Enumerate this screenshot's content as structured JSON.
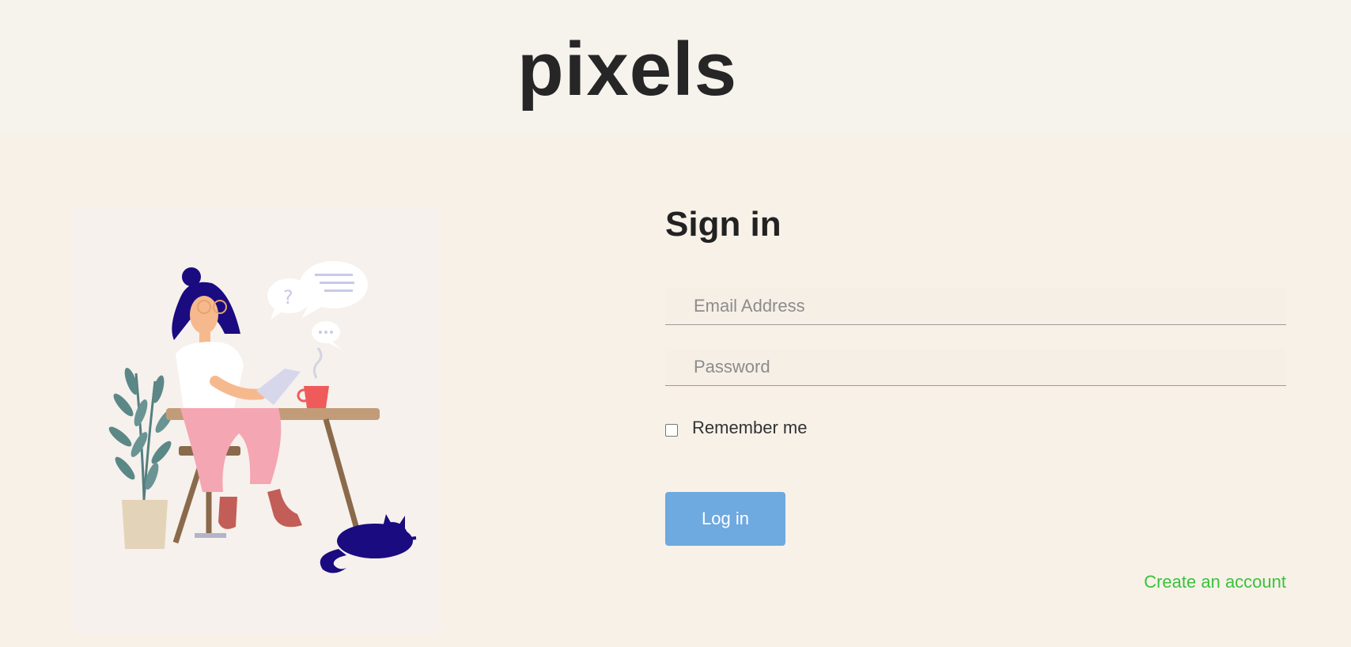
{
  "header": {
    "brand": "pixels"
  },
  "signin": {
    "title": "Sign in",
    "email_placeholder": "Email Address",
    "password_placeholder": "Password",
    "remember_label": "Remember me",
    "remember_checked": false,
    "login_label": "Log in",
    "create_account_label": "Create an account"
  },
  "illustration": {
    "icon": "woman-working-at-desk-illustration"
  },
  "colors": {
    "background": "#f7f1e8",
    "button": "#6ea9e0",
    "link": "#39c23c",
    "illustration_hair": "#1a0b80",
    "illustration_pants": "#f4a6b3",
    "illustration_cup": "#ef5b5b"
  }
}
